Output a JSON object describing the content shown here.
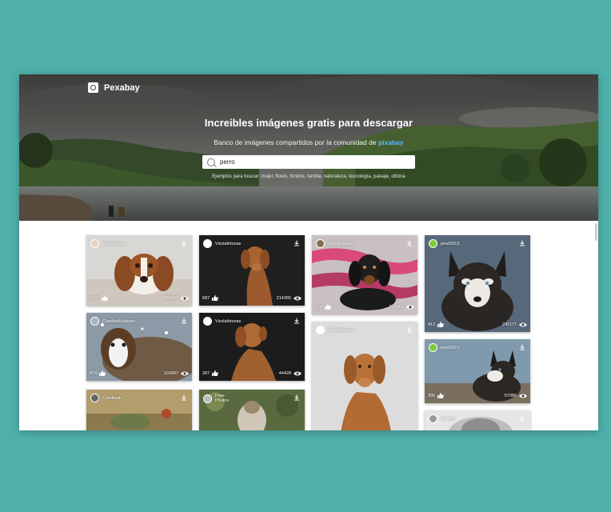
{
  "site": {
    "logo_text": "Pexabay",
    "hero_title": "Increibles imágenes gratis para descargar",
    "hero_subtitle": "Banco de imágenes compartidos por la comunidad de",
    "hero_brand": "pixabay",
    "examples": "Ejemplos para buscar: mujer, flores, fondos, familia, naturaleza, tecnología, paisaje, oficina"
  },
  "search": {
    "value": "perro",
    "placeholder": ""
  },
  "colors": {
    "background": "#4fb0aa",
    "brand_link": "#5ab7ff"
  },
  "cards": [
    {
      "user": "PicsbyFran",
      "likes": "1193",
      "views": "457467",
      "icon": "download-icon",
      "avatar": "#e8d3c0"
    },
    {
      "user": "Vizslafotozas",
      "likes": "687",
      "views": "214365",
      "icon": "download-icon",
      "avatar": "#ffffff"
    },
    {
      "user": "congerdesign",
      "likes": "578",
      "views": "220661",
      "icon": "download-icon",
      "avatar": "#8a6a4a"
    },
    {
      "user": "pixel2013",
      "likes": "412",
      "views": "241177",
      "icon": "download-icon",
      "avatar": "#7ecb3a"
    },
    {
      "user": "ClaudiaWollesen",
      "likes": "474",
      "views": "101897",
      "icon": "download-icon",
      "avatar": "#a7b2bd"
    },
    {
      "user": "Vizslafotozas",
      "likes": "287",
      "views": "44428",
      "icon": "download-icon",
      "avatar": "#ffffff"
    },
    {
      "user": "Vizslafotozas",
      "likes": "",
      "views": "",
      "icon": "download-icon",
      "avatar": "#ffffff"
    },
    {
      "user": "pixel2013",
      "likes": "305",
      "views": "57086",
      "icon": "download-icon",
      "avatar": "#7ecb3a"
    },
    {
      "user": "Comfreak",
      "likes": "",
      "views": "",
      "icon": "download-icon",
      "avatar": "#666666"
    },
    {
      "user": "Free-Photos",
      "likes": "",
      "views": "",
      "icon": "download-icon",
      "avatar": "#bbbbbb"
    },
    {
      "user": "Gordon",
      "likes": "",
      "views": "",
      "icon": "download-icon",
      "avatar": "#999999"
    }
  ]
}
